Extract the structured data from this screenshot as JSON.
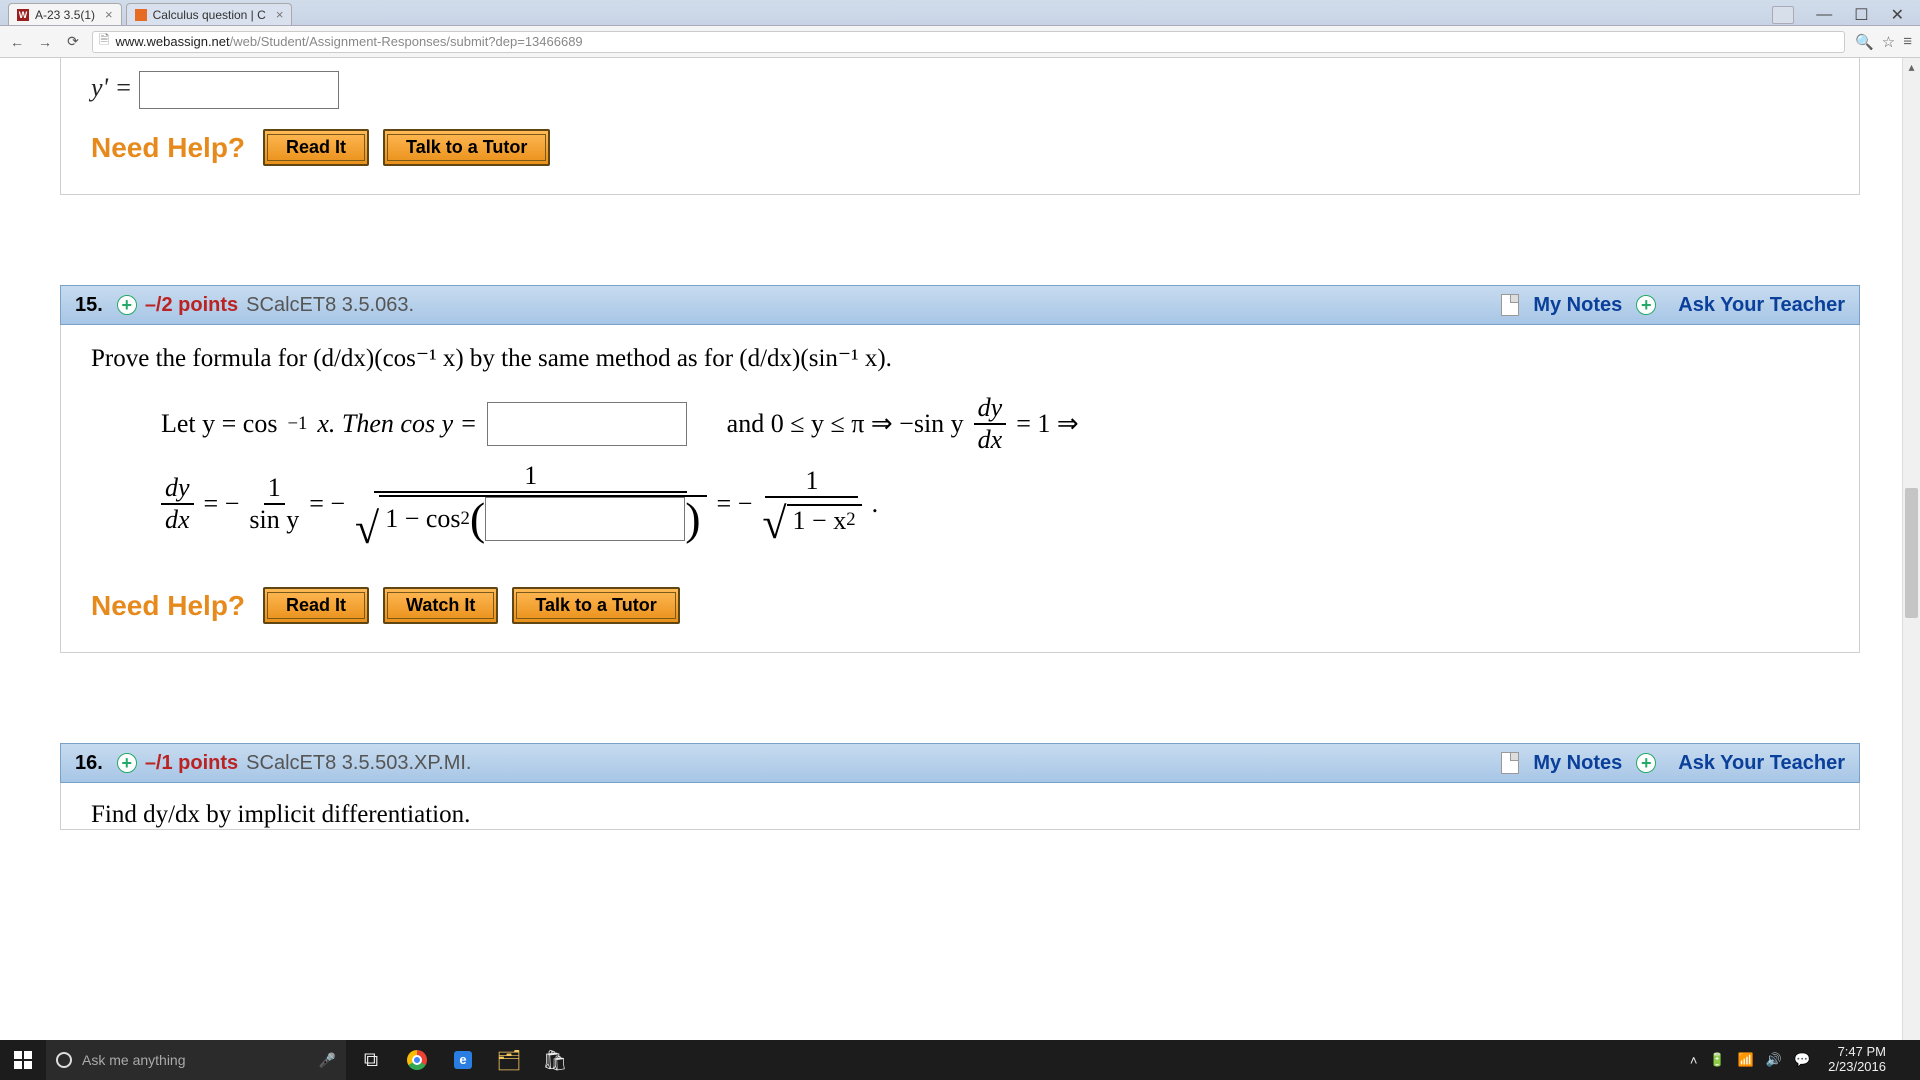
{
  "browser": {
    "tabs": [
      {
        "title": "A-23 3.5(1)"
      },
      {
        "title": "Calculus question | C"
      }
    ],
    "url_host": "www.webassign.net",
    "url_path": "/web/Student/Assignment-Responses/submit?dep=13466689"
  },
  "q_top": {
    "yprime": "y' =",
    "need_help": "Need Help?",
    "read_it": "Read It",
    "talk_tutor": "Talk to a Tutor"
  },
  "q15": {
    "number": "15.",
    "points": "–/2 points",
    "ref": "SCalcET8 3.5.063.",
    "my_notes": "My Notes",
    "ask_teacher": "Ask Your Teacher",
    "prove": "Prove the formula for  (d/dx)(cos⁻¹ x)  by the same method as for  (d/dx)(sin⁻¹ x).",
    "line1_a": "Let  y = cos",
    "line1_b": " x.  Then  cos y =",
    "line1_c": "and  0 ≤ y ≤ π  ⇒  −sin y ",
    "line1_d": " = 1  ⇒",
    "dy": "dy",
    "dx": "dx",
    "eqmm": " = − ",
    "one": "1",
    "siny": "sin y",
    "one_minus_cos2": "1 − cos",
    "sq_exp": "2",
    "one_minus_x2": "1 − x",
    "period": ".",
    "need_help": "Need Help?",
    "read_it": "Read It",
    "watch_it": "Watch It",
    "talk_tutor": "Talk to a Tutor"
  },
  "q16": {
    "number": "16.",
    "points": "–/1 points",
    "ref": "SCalcET8 3.5.503.XP.MI.",
    "my_notes": "My Notes",
    "ask_teacher": "Ask Your Teacher",
    "prompt": "Find dy/dx by implicit differentiation."
  },
  "taskbar": {
    "search_placeholder": "Ask me anything",
    "time": "7:47 PM",
    "date": "2/23/2016"
  }
}
